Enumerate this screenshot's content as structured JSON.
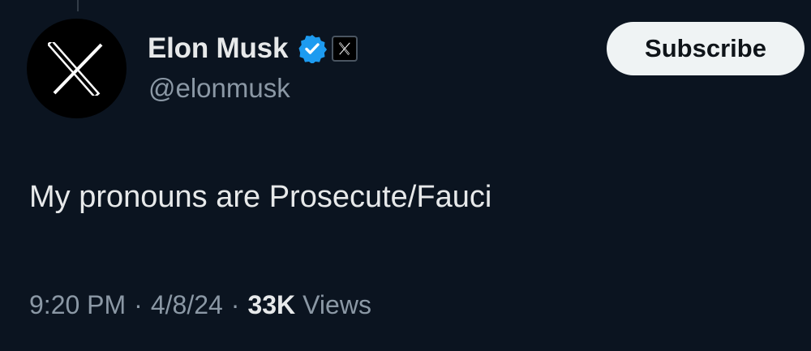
{
  "author": {
    "display_name": "Elon Musk",
    "handle": "@elonmusk",
    "avatar_icon": "x-logo-icon",
    "verified_icon": "verified-badge-icon",
    "affiliate_icon": "x-affiliate-badge-icon"
  },
  "actions": {
    "subscribe_label": "Subscribe"
  },
  "tweet": {
    "text": "My pronouns are Prosecute/Fauci",
    "time": "9:20 PM",
    "separator": "·",
    "date": "4/8/24",
    "views_count": "33K",
    "views_label": "Views"
  },
  "colors": {
    "background": "#0b1420",
    "primary_text": "#e7e9ea",
    "secondary_text": "#8b98a5",
    "verified_blue": "#1d9bf0",
    "button_bg": "#eff3f4"
  }
}
